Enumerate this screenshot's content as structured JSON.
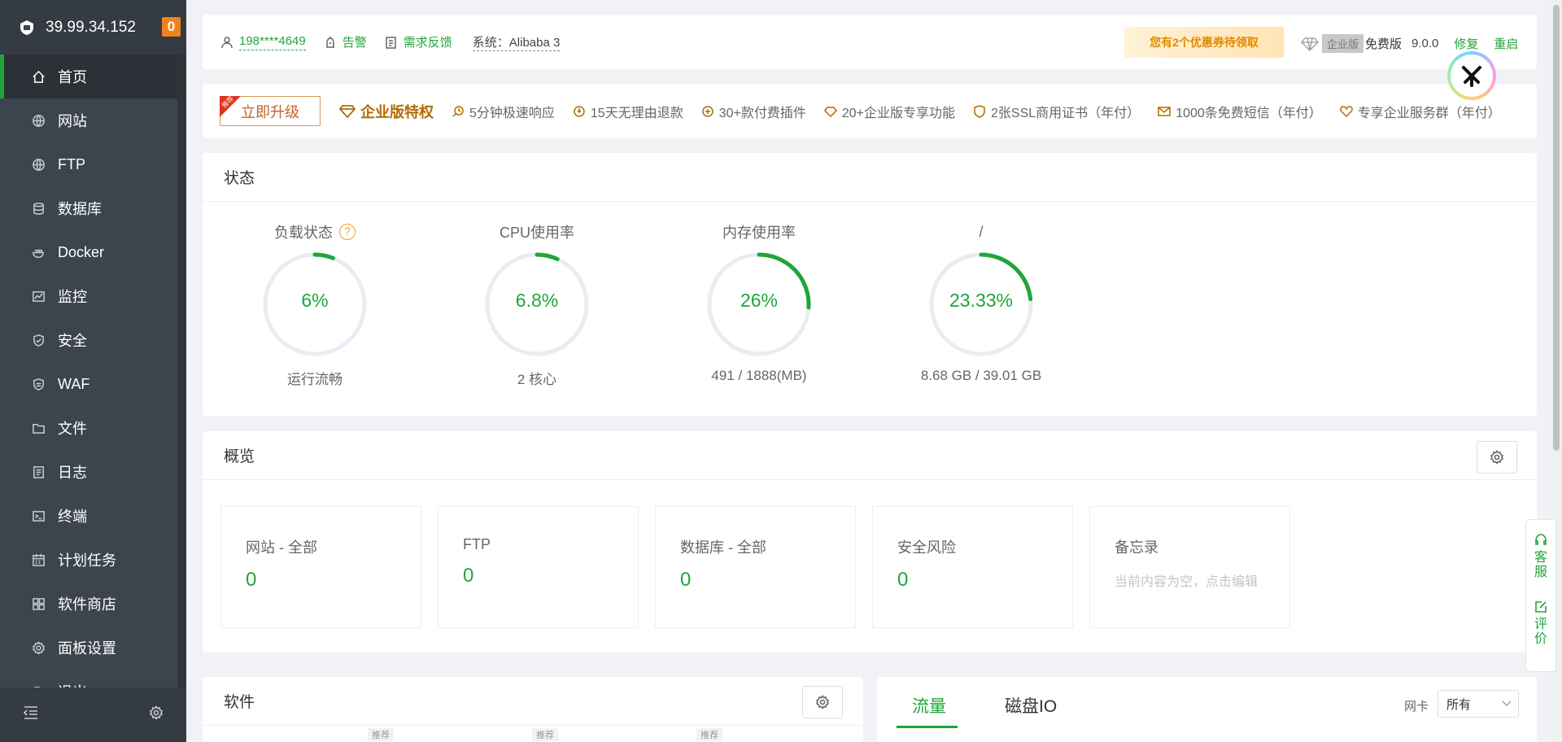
{
  "sidebar": {
    "server_ip": "39.99.34.152",
    "badge_count": "0",
    "items": [
      {
        "label": "首页",
        "icon": "home-icon"
      },
      {
        "label": "网站",
        "icon": "globe-icon"
      },
      {
        "label": "FTP",
        "icon": "globe-icon"
      },
      {
        "label": "数据库",
        "icon": "database-icon"
      },
      {
        "label": "Docker",
        "icon": "docker-icon"
      },
      {
        "label": "监控",
        "icon": "monitor-icon"
      },
      {
        "label": "安全",
        "icon": "shield-icon"
      },
      {
        "label": "WAF",
        "icon": "waf-icon"
      },
      {
        "label": "文件",
        "icon": "folder-icon"
      },
      {
        "label": "日志",
        "icon": "log-icon"
      },
      {
        "label": "终端",
        "icon": "terminal-icon"
      },
      {
        "label": "计划任务",
        "icon": "calendar-icon"
      },
      {
        "label": "软件商店",
        "icon": "grid-icon"
      },
      {
        "label": "面板设置",
        "icon": "gear-icon"
      },
      {
        "label": "退出",
        "icon": "logout-icon"
      }
    ]
  },
  "topbar": {
    "user": "198****4649",
    "alarm": "告警",
    "feedback": "需求反馈",
    "system": "系统：Alibaba 3",
    "coupon": "您有2个优惠券待领取",
    "enterprise_tag": "企业版",
    "edition": "免费版",
    "version": "9.0.0",
    "repair": "修复",
    "restart": "重启"
  },
  "upgrade": {
    "button": "立即升级",
    "corner": "推荐",
    "title": "企业版特权",
    "features": [
      "5分钟极速响应",
      "15天无理由退款",
      "30+款付费插件",
      "20+企业版专享功能",
      "2张SSL商用证书（年付）",
      "1000条免费短信（年付）",
      "专享企业服务群（年付）"
    ]
  },
  "status": {
    "title": "状态",
    "gauges": [
      {
        "title": "负载状态",
        "value": "6%",
        "percent": 6,
        "sub": "运行流畅",
        "help": "?"
      },
      {
        "title": "CPU使用率",
        "value": "6.8%",
        "percent": 6.8,
        "sub": "2 核心"
      },
      {
        "title": "内存使用率",
        "value": "26%",
        "percent": 26,
        "sub": "491 / 1888(MB)"
      },
      {
        "title": "/",
        "value": "23.33%",
        "percent": 23.33,
        "sub": "8.68 GB / 39.01 GB"
      }
    ],
    "colors": {
      "ring_track": "#e9ecf3",
      "ring_fill": "#20a53a"
    }
  },
  "overview": {
    "title": "概览",
    "boxes": [
      {
        "title": "网站 - 全部",
        "value": "0"
      },
      {
        "title": "FTP",
        "value": "0"
      },
      {
        "title": "数据库 - 全部",
        "value": "0"
      },
      {
        "title": "安全风险",
        "value": "0"
      }
    ],
    "memo": {
      "title": "备忘录",
      "placeholder": "当前内容为空，点击编辑"
    }
  },
  "software": {
    "title": "软件",
    "tags": [
      "推荐",
      "推荐",
      "推荐"
    ]
  },
  "traffic": {
    "tabs": [
      "流量",
      "磁盘IO"
    ],
    "nic_label": "网卡",
    "nic_value": "所有"
  },
  "float_service": {
    "service": [
      "客",
      "服"
    ],
    "rate": [
      "评",
      "价"
    ]
  }
}
